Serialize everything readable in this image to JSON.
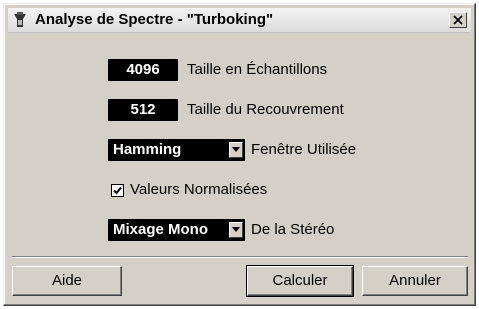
{
  "window": {
    "title": "Analyse de Spectre - \"Turboking\""
  },
  "fields": {
    "sample_size": {
      "value": "4096",
      "label": "Taille en Échantillons"
    },
    "overlap": {
      "value": "512",
      "label": "Taille du Recouvrement"
    },
    "window_fn": {
      "value": "Hamming",
      "label": "Fenêtre Utilisée"
    },
    "normalized": {
      "checked": true,
      "label": "Valeurs Normalisées"
    },
    "stereo_mix": {
      "value": "Mixage Mono",
      "label": "De la Stéréo"
    }
  },
  "buttons": {
    "help": "Aide",
    "compute": "Calculer",
    "cancel": "Annuler"
  },
  "icons": {
    "app": "app-icon",
    "close": "close-icon",
    "dropdown": "chevron-down-icon",
    "check": "checkmark-icon"
  }
}
